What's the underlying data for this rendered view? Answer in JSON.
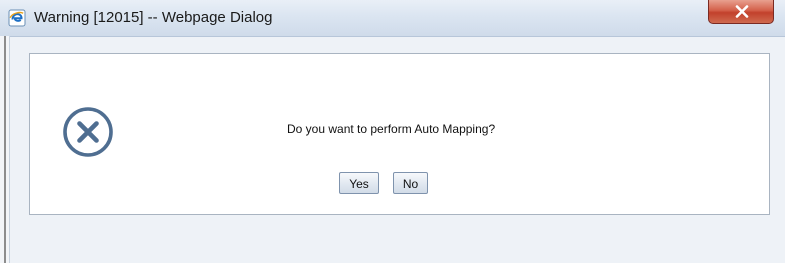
{
  "window": {
    "title": "Warning [12015] -- Webpage Dialog",
    "title_icon": "ie-icon",
    "close_icon": "close-icon",
    "close_color": "#c9452f"
  },
  "dialog": {
    "icon": "error-x-icon",
    "icon_color": "#4f6e91",
    "message": "Do you want to perform Auto Mapping?",
    "buttons": {
      "yes_label": "Yes",
      "no_label": "No"
    }
  }
}
